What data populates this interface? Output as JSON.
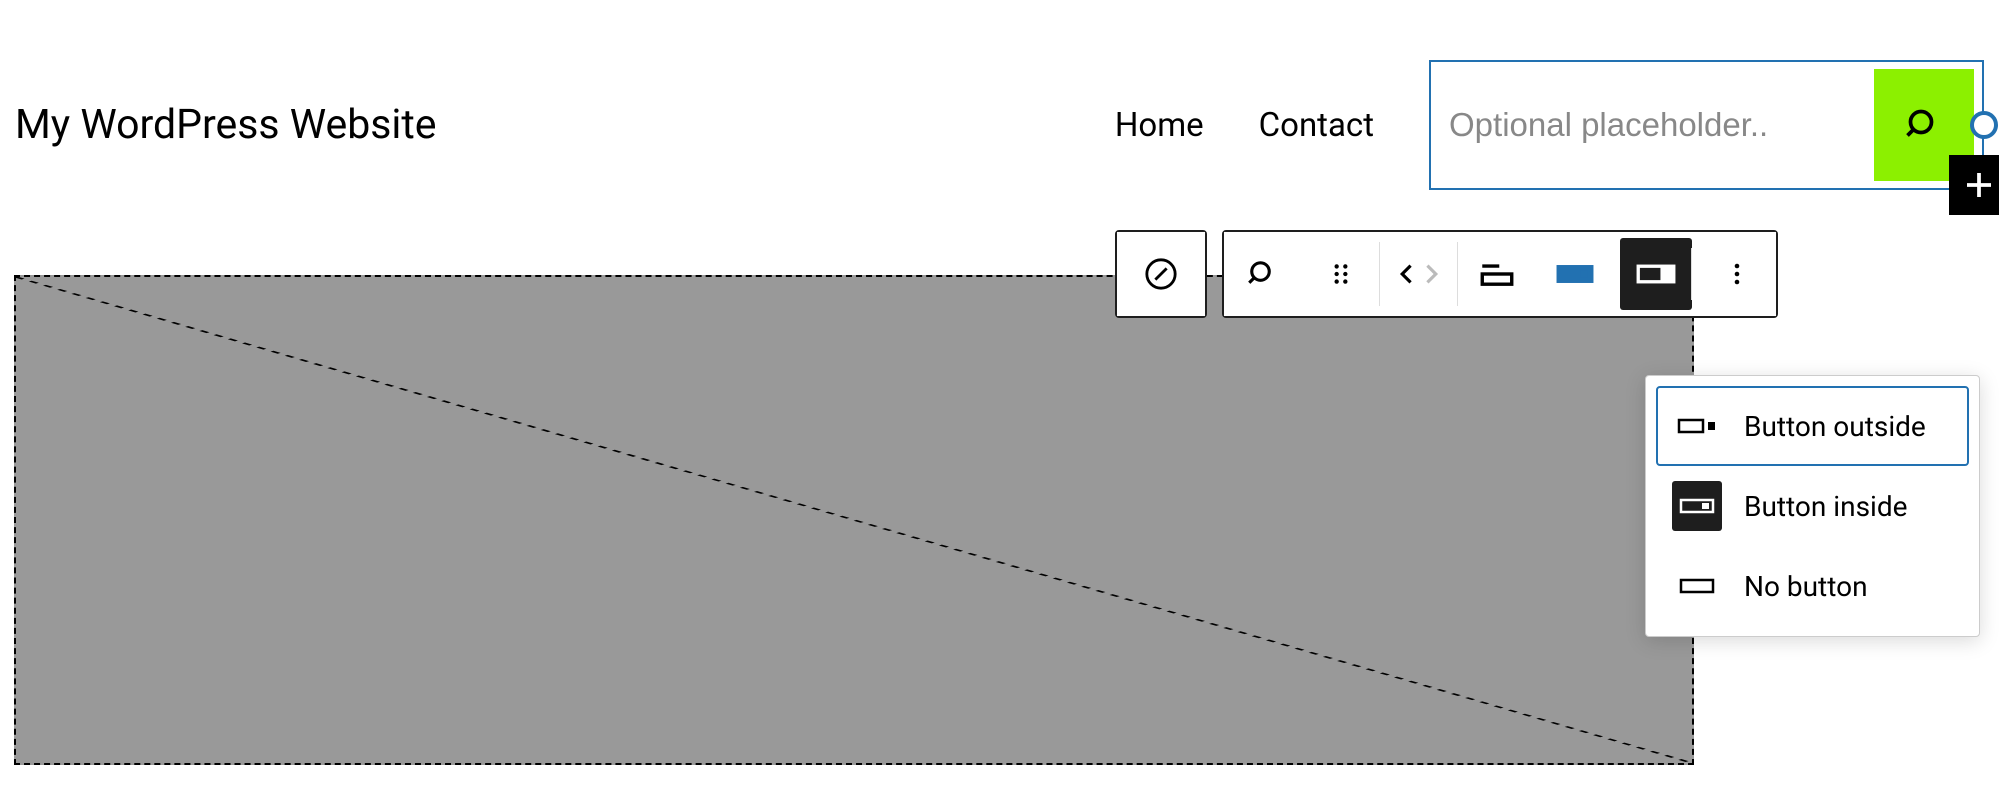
{
  "site": {
    "title": "My WordPress Website"
  },
  "nav": {
    "items": [
      {
        "label": "Home"
      },
      {
        "label": "Contact"
      }
    ]
  },
  "search": {
    "placeholder": "Optional placeholder..",
    "value": ""
  },
  "toolbar": {
    "icons": {
      "explore": "compass-icon",
      "search_block": "search-icon",
      "drag": "drag-handle-icon",
      "move": "chevrons-icon",
      "layout1": "layout-top-icon",
      "layout2": "layout-button-icon",
      "layout3": "layout-inside-icon",
      "more": "more-vertical-icon"
    }
  },
  "dropdown": {
    "items": [
      {
        "label": "Button outside",
        "icon": "button-outside-icon",
        "selected": true,
        "current": false
      },
      {
        "label": "Button inside",
        "icon": "button-inside-icon",
        "selected": false,
        "current": true
      },
      {
        "label": "No button",
        "icon": "no-button-icon",
        "selected": false,
        "current": false
      }
    ]
  }
}
